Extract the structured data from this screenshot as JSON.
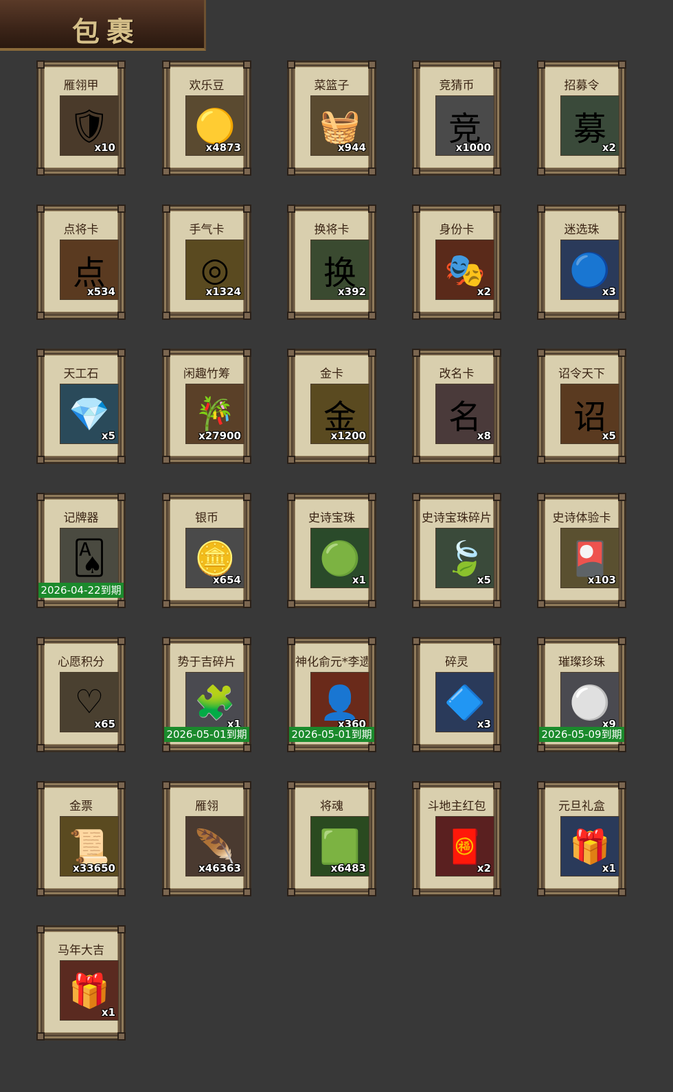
{
  "title": "包裹",
  "items": [
    {
      "name": "雁翎甲",
      "count": "x10",
      "icon": "armor-icon",
      "bg": "#4a3a2a",
      "glyph": "🛡"
    },
    {
      "name": "欢乐豆",
      "count": "x4873",
      "icon": "gold-beans-icon",
      "bg": "#5a4a30",
      "glyph": "🟡"
    },
    {
      "name": "菜篮子",
      "count": "x944",
      "icon": "basket-icon",
      "bg": "#5a4a30",
      "glyph": "🧺"
    },
    {
      "name": "竞猜币",
      "count": "x1000",
      "icon": "quiz-coin-icon",
      "bg": "#4a4a4a",
      "glyph": "竞"
    },
    {
      "name": "招募令",
      "count": "x2",
      "icon": "recruit-token-icon",
      "bg": "#3a4a3a",
      "glyph": "募"
    },
    {
      "name": "点将卡",
      "count": "x534",
      "icon": "general-card-icon",
      "bg": "#5a3a20",
      "glyph": "点"
    },
    {
      "name": "手气卡",
      "count": "x1324",
      "icon": "luck-card-icon",
      "bg": "#5a4a20",
      "glyph": "◎"
    },
    {
      "name": "换将卡",
      "count": "x392",
      "icon": "swap-card-icon",
      "bg": "#3a4a30",
      "glyph": "换"
    },
    {
      "name": "身份卡",
      "count": "x2",
      "icon": "identity-card-icon",
      "bg": "#5a2a1a",
      "glyph": "🎭"
    },
    {
      "name": "迷选珠",
      "count": "x3",
      "icon": "blue-orb-icon",
      "bg": "#2a3a5a",
      "glyph": "🔵"
    },
    {
      "name": "天工石",
      "count": "x5",
      "icon": "blue-crystal-icon",
      "bg": "#2a4a5a",
      "glyph": "💎"
    },
    {
      "name": "闲趣竹筹",
      "count": "x27900",
      "icon": "bamboo-token-icon",
      "bg": "#5a4028",
      "glyph": "🎋"
    },
    {
      "name": "金卡",
      "count": "x1200",
      "icon": "gold-card-icon",
      "bg": "#5a4a20",
      "glyph": "金"
    },
    {
      "name": "改名卡",
      "count": "x8",
      "icon": "rename-card-icon",
      "bg": "#4a3a3a",
      "glyph": "名"
    },
    {
      "name": "诏令天下",
      "count": "x5",
      "icon": "edict-scroll-icon",
      "bg": "#5a3a20",
      "glyph": "诏"
    },
    {
      "name": "记牌器",
      "count": "",
      "icon": "playing-cards-icon",
      "bg": "#4a4a40",
      "glyph": "🂡",
      "expire": "2026-04-22到期"
    },
    {
      "name": "银币",
      "count": "x654",
      "icon": "silver-coin-icon",
      "bg": "#4a4a4a",
      "glyph": "🪙"
    },
    {
      "name": "史诗宝珠",
      "count": "x1",
      "icon": "green-orb-icon",
      "bg": "#2a4a2a",
      "glyph": "🟢"
    },
    {
      "name": "史诗宝珠碎片",
      "count": "x5",
      "icon": "green-shard-icon",
      "bg": "#3a4a3a",
      "glyph": "🍃"
    },
    {
      "name": "史诗体验卡",
      "count": "x103",
      "icon": "trial-card-icon",
      "bg": "#5a5030",
      "glyph": "🎴"
    },
    {
      "name": "心愿积分",
      "count": "x65",
      "icon": "heart-coin-icon",
      "bg": "#4a4030",
      "glyph": "♡"
    },
    {
      "name": "势于吉碎片",
      "count": "x1",
      "icon": "hero-fragment-icon",
      "bg": "#4a4a50",
      "glyph": "🧩",
      "expire": "2026-05-01到期"
    },
    {
      "name": "神化俞元*李遗碎片",
      "count": "x360",
      "icon": "hero-portrait-icon",
      "bg": "#6a2a1a",
      "glyph": "👤",
      "expire": "2026-05-01到期"
    },
    {
      "name": "碎灵",
      "count": "x3",
      "icon": "spirit-shard-icon",
      "bg": "#2a3a5a",
      "glyph": "🔷"
    },
    {
      "name": "璀璨珍珠",
      "count": "x9",
      "icon": "pearl-icon",
      "bg": "#4a4a50",
      "glyph": "⚪",
      "expire": "2026-05-09到期"
    },
    {
      "name": "金票",
      "count": "x33650",
      "icon": "gold-ticket-icon",
      "bg": "#5a4a20",
      "glyph": "📜"
    },
    {
      "name": "雁翎",
      "count": "x46363",
      "icon": "feather-icon",
      "bg": "#4a3a30",
      "glyph": "🪶"
    },
    {
      "name": "将魂",
      "count": "x6483",
      "icon": "general-soul-icon",
      "bg": "#2a4a20",
      "glyph": "🟩"
    },
    {
      "name": "斗地主红包",
      "count": "x2",
      "icon": "red-envelope-icon",
      "bg": "#5a2020",
      "glyph": "🧧"
    },
    {
      "name": "元旦礼盒",
      "count": "x1",
      "icon": "gift-box-blue-icon",
      "bg": "#2a3a5a",
      "glyph": "🎁"
    },
    {
      "name": "马年大吉",
      "count": "x1",
      "icon": "gift-box-red-icon",
      "bg": "#5a2a20",
      "glyph": "🎁"
    }
  ]
}
